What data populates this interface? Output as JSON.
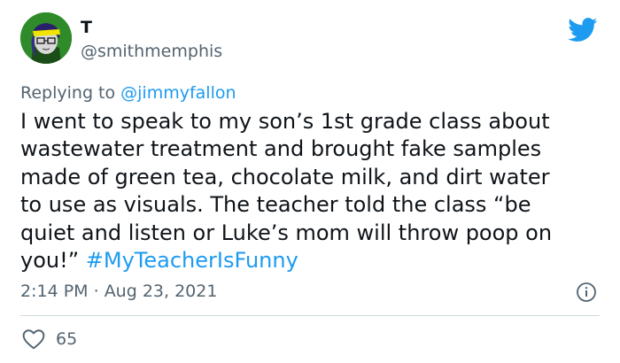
{
  "user": {
    "name": "T",
    "handle": "@smithmemphis",
    "avatar_icon": "cartoon-avatar-icon"
  },
  "reply": {
    "prefix": "Replying to ",
    "to_handle": "@jimmyfallon"
  },
  "tweet": {
    "text": "I went to speak to my son’s 1st grade class about\nwastewater treatment and brought fake samples\nmade of green tea, chocolate milk, and dirt water\nto use as visuals. The teacher told the class “be\nquiet and listen or Luke’s mom will throw poop on\nyou!” ",
    "hashtag": "#MyTeacherIsFunny"
  },
  "meta": {
    "time": "2:14 PM",
    "separator": " · ",
    "date": "Aug 23, 2021"
  },
  "actions": {
    "like_count": "65"
  },
  "icons": {
    "brand": "twitter-bird-icon",
    "info": "info-icon",
    "like": "heart-icon"
  },
  "colors": {
    "link": "#1d9bf0",
    "secondary_text": "#536471",
    "primary_text": "#0f1419",
    "divider": "#cfd9de",
    "brand": "#1d9bf0"
  }
}
